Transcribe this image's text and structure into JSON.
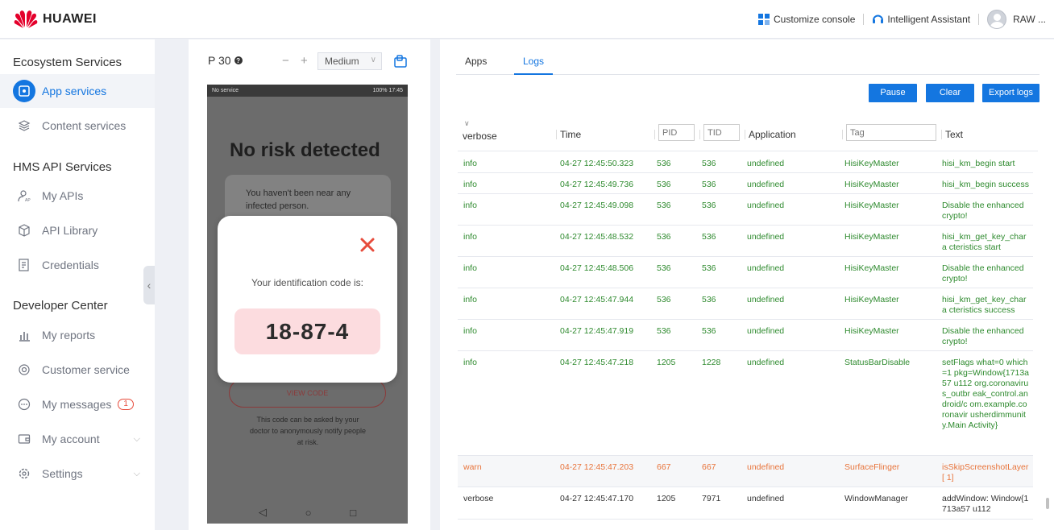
{
  "topbar": {
    "brand": "HUAWEI",
    "customize_console": "Customize console",
    "intelligent_assistant": "Intelligent Assistant",
    "user": "RAW ..."
  },
  "sidebar": {
    "sections": [
      {
        "title": "Ecosystem Services"
      },
      {
        "title": "HMS API Services"
      },
      {
        "title": "Developer Center"
      }
    ],
    "items": [
      {
        "label": "App services",
        "icon": "app-services-icon",
        "active": true
      },
      {
        "label": "Content services",
        "icon": "layers-icon"
      },
      {
        "label": "My APIs",
        "icon": "user-api-icon"
      },
      {
        "label": "API Library",
        "icon": "cube-icon"
      },
      {
        "label": "Credentials",
        "icon": "document-icon"
      },
      {
        "label": "My reports",
        "icon": "bar-chart-icon"
      },
      {
        "label": "Customer service",
        "icon": "headset-icon"
      },
      {
        "label": "My messages",
        "icon": "message-icon",
        "badge": "1"
      },
      {
        "label": "My account",
        "icon": "wallet-icon"
      },
      {
        "label": "Settings",
        "icon": "gear-icon"
      }
    ]
  },
  "device": {
    "model": "P 30",
    "zoom_minus": "−",
    "zoom_plus": "+",
    "zoom_level": "Medium",
    "status_left": "No service",
    "status_right": "100% 17:45",
    "heading": "No risk detected",
    "card_text": "You haven't been near any infected person.",
    "view_code": "VIEW CODE",
    "note": "This code can be asked by your doctor to anonymously notify people at risk.",
    "modal_label": "Your identification code is:",
    "modal_code": "18-87-4"
  },
  "logs": {
    "tabs": [
      "Apps",
      "Logs"
    ],
    "active_tab": "Logs",
    "buttons": {
      "pause": "Pause",
      "clear": "Clear",
      "export": "Export logs"
    },
    "headers": {
      "level": "verbose",
      "time": "Time",
      "pid_placeholder": "PID",
      "tid_placeholder": "TID",
      "application": "Application",
      "tag_placeholder": "Tag",
      "text": "Text"
    },
    "rows": [
      {
        "level": "info",
        "time": "04-27 12:45:50.323",
        "pid": "536",
        "tid": "536",
        "app": "undefined",
        "tag": "HisiKeyMaster",
        "text": "hisi_km_begin start"
      },
      {
        "level": "info",
        "time": "04-27 12:45:49.736",
        "pid": "536",
        "tid": "536",
        "app": "undefined",
        "tag": "HisiKeyMaster",
        "text": "hisi_km_begin success"
      },
      {
        "level": "info",
        "time": "04-27 12:45:49.098",
        "pid": "536",
        "tid": "536",
        "app": "undefined",
        "tag": "HisiKeyMaster",
        "text": "Disable the enhanced crypto!"
      },
      {
        "level": "info",
        "time": "04-27 12:45:48.532",
        "pid": "536",
        "tid": "536",
        "app": "undefined",
        "tag": "HisiKeyMaster",
        "text": "hisi_km_get_key_chara cteristics start"
      },
      {
        "level": "info",
        "time": "04-27 12:45:48.506",
        "pid": "536",
        "tid": "536",
        "app": "undefined",
        "tag": "HisiKeyMaster",
        "text": "Disable the enhanced crypto!"
      },
      {
        "level": "info",
        "time": "04-27 12:45:47.944",
        "pid": "536",
        "tid": "536",
        "app": "undefined",
        "tag": "HisiKeyMaster",
        "text": "hisi_km_get_key_chara cteristics success"
      },
      {
        "level": "info",
        "time": "04-27 12:45:47.919",
        "pid": "536",
        "tid": "536",
        "app": "undefined",
        "tag": "HisiKeyMaster",
        "text": "Disable the enhanced crypto!"
      },
      {
        "level": "info",
        "time": "04-27 12:45:47.218",
        "pid": "1205",
        "tid": "1228",
        "app": "undefined",
        "tag": "StatusBarDisable",
        "text": "setFlags what=0 which=1 pkg=Window{1713a57 u112 org.coronavirus_outbr eak_control.android/c om.example.coronavir usherdimmunity.Main Activity}"
      },
      {
        "level": "warn",
        "time": "04-27 12:45:47.203",
        "pid": "667",
        "tid": "667",
        "app": "undefined",
        "tag": "SurfaceFlinger",
        "text": "isSkipScreenshotLayer[ 1]"
      },
      {
        "level": "verbose",
        "time": "04-27 12:45:47.170",
        "pid": "1205",
        "tid": "7971",
        "app": "undefined",
        "tag": "WindowManager",
        "text": "addWindow: Window{1713a57 u112"
      }
    ]
  },
  "colors": {
    "accent": "#1476e0",
    "info": "#2e8a2e",
    "warn": "#e8743b",
    "code_bg": "#fcdcdf",
    "close": "#e74c3c"
  }
}
